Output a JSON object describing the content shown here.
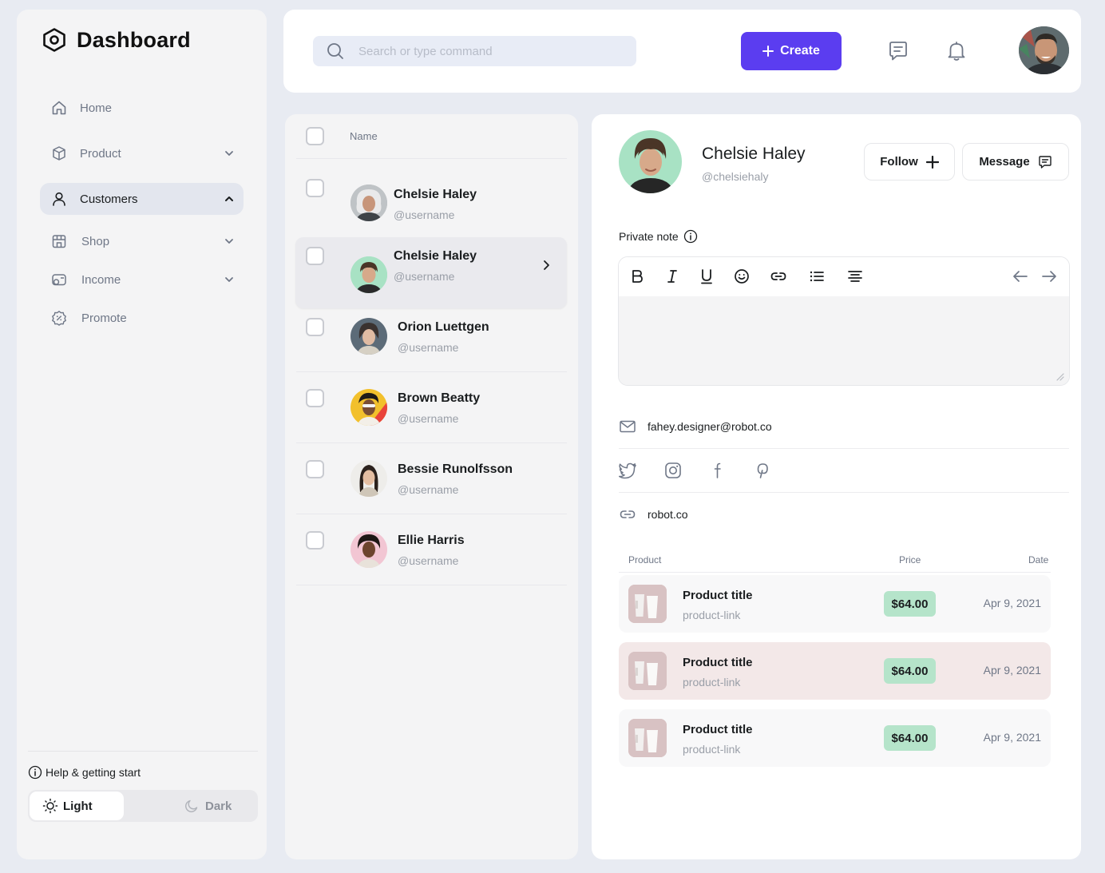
{
  "app": {
    "title": "Dashboard"
  },
  "sidebar": {
    "items": [
      {
        "label": "Home"
      },
      {
        "label": "Product"
      },
      {
        "label": "Customers"
      },
      {
        "label": "Shop"
      },
      {
        "label": "Income"
      },
      {
        "label": "Promote"
      }
    ],
    "help_label": "Help & getting start",
    "theme": {
      "light_label": "Light",
      "dark_label": "Dark",
      "selected": "Light"
    }
  },
  "topbar": {
    "search_placeholder": "Search or type command",
    "create_label": "Create"
  },
  "customer_list": {
    "column_name": "Name",
    "rows": [
      {
        "name": "Chelsie Haley",
        "username": "@username"
      },
      {
        "name": "Chelsie Haley",
        "username": "@username",
        "selected": true
      },
      {
        "name": "Orion Luettgen",
        "username": "@username"
      },
      {
        "name": "Brown Beatty",
        "username": "@username"
      },
      {
        "name": "Bessie Runolfsson",
        "username": "@username"
      },
      {
        "name": "Ellie Harris",
        "username": "@username"
      }
    ]
  },
  "profile": {
    "name": "Chelsie Haley",
    "handle": "@chelsiehaly",
    "follow_label": "Follow",
    "message_label": "Message",
    "private_note_label": "Private note",
    "email": "fahey.designer@robot.co",
    "website": "robot.co",
    "social": [
      "twitter-icon",
      "instagram-icon",
      "facebook-icon",
      "pinterest-icon"
    ]
  },
  "purchases": {
    "headers": {
      "product": "Product",
      "price": "Price",
      "date": "Date"
    },
    "rows": [
      {
        "title": "Product title",
        "link": "product-link",
        "price": "$64.00",
        "date": "Apr 9, 2021"
      },
      {
        "title": "Product title",
        "link": "product-link",
        "price": "$64.00",
        "date": "Apr 9, 2021"
      },
      {
        "title": "Product title",
        "link": "product-link",
        "price": "$64.00",
        "date": "Apr 9, 2021"
      }
    ]
  },
  "colors": {
    "accent": "#5B3DF0",
    "price_badge": "#B5E4CA",
    "highlight_row": "#F3E8E8",
    "page_bg": "#E8EBF2"
  }
}
